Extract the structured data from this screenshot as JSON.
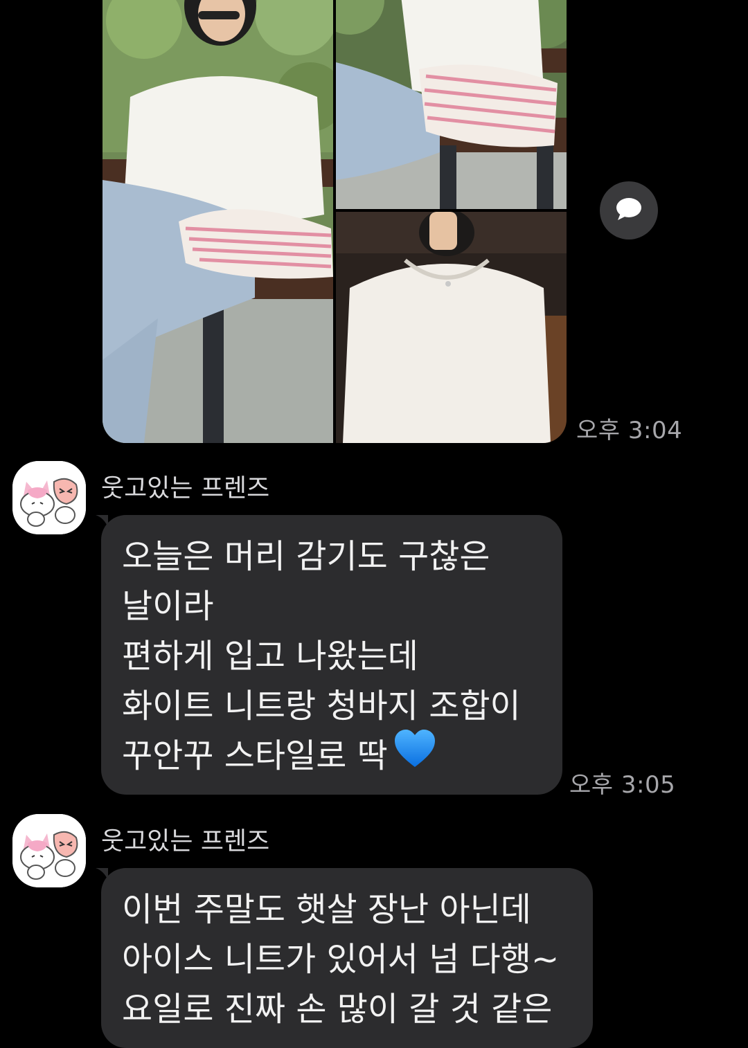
{
  "photo_message": {
    "time": "오후 3:04",
    "photos": [
      {
        "alt": "woman in white knit sitting on bench with striped bag"
      },
      {
        "alt": "seated woman in white knit and jeans with bag"
      },
      {
        "alt": "woman in white knit taking selfie"
      }
    ]
  },
  "messages": [
    {
      "sender": "웃고있는 프렌즈",
      "lines": [
        "오늘은 머리 감기도 구찮은",
        "날이라",
        "편하게 입고 나왔는데",
        "화이트 니트랑 청바지 조합이",
        "꾸안꾸 스타일로 딱"
      ],
      "time": "오후 3:05"
    },
    {
      "sender": "웃고있는 프렌즈",
      "lines": [
        "이번 주말도 햇살 장난 아닌데",
        "아이스 니트가 있어서 넘 다행~",
        "요일로 진짜 손 많이 갈 것 같은"
      ]
    }
  ],
  "icons": {
    "share": "speech-bubble-icon",
    "heart": "blue-heart-emoji",
    "avatar": "cat-and-peach-character-icon"
  },
  "colors": {
    "background": "#000000",
    "bubble": "#2c2c2e",
    "time_text": "#a7a7ab",
    "heart": "#1e90ff"
  }
}
